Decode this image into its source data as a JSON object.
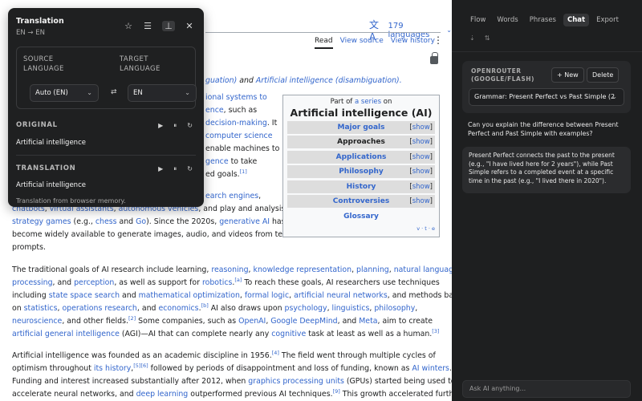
{
  "wiki": {
    "languages_label": "179 languages",
    "view_tabs": [
      "Read",
      "View source",
      "View history"
    ],
    "hatnote_rest": "guation) and ",
    "hatnote_link": "Artificial intelligence (disambiguation).",
    "p1_lines": [
      "ional systems to",
      "ence, such as",
      "decision-making. It",
      "computer science",
      "enable machines to",
      "gence to take",
      "ed goals."
    ],
    "p1_cont": [
      "earch engines,",
      "chatbots, virtual assistants, autonomous vehicles, and play and analysis in",
      "strategy games (e.g., chess and Go). Since the 2020s, generative AI has",
      "become widely available to generate images, audio, and videos from text",
      "prompts."
    ],
    "p2_lines": [
      "The traditional goals of AI research include learning, reasoning, knowledge representation, planning, natural language",
      "processing, and perception, as well as support for robotics. To reach these goals, AI researchers use techniques",
      "including state space search and mathematical optimization, formal logic, artificial neural networks, and methods based",
      "on statistics, operations research, and economics. AI also draws upon psychology, linguistics, philosophy,",
      "neuroscience, and other fields. Some companies, such as OpenAI, Google DeepMind, and Meta, aim to create",
      "artificial general intelligence (AGI)—AI that can complete nearly any cognitive task at least as well as a human."
    ],
    "p3_lines": [
      "Artificial intelligence was founded as an academic discipline in 1956. The field went through multiple cycles of",
      "optimism throughout its history, followed by periods of disappointment and loss of funding, known as AI winters.",
      "Funding and interest increased substantially after 2012, when graphics processing units (GPUs) started being used to",
      "accelerate neural networks, and deep learning outperformed previous AI techniques. This growth accelerated further"
    ],
    "infobox": {
      "pre_text": "Part of ",
      "pre_link": "a series",
      "pre_tail": " on",
      "title": "Artificial intelligence (AI)",
      "rows": [
        "Major goals",
        "Approaches",
        "Applications",
        "Philosophy",
        "History",
        "Controversies"
      ],
      "show_label": "show",
      "glossary": "Glossary",
      "vte": "v · t · e"
    }
  },
  "translation": {
    "title": "Translation",
    "pair": "EN → EN",
    "source_label": "SOURCE LANGUAGE",
    "target_label": "TARGET LANGUAGE",
    "source_value": "Auto (EN)",
    "target_value": "EN",
    "original_label": "ORIGINAL",
    "original_text": "Artificial intelligence",
    "translation_label": "TRANSLATION",
    "translation_text": "Artificial intelligence",
    "memory_note": "Translation from browser memory."
  },
  "sidebar": {
    "tabs": [
      "Flow",
      "Words",
      "Phrases",
      "Chat",
      "Export"
    ],
    "active_tab": "Chat",
    "provider": "OPENROUTER (GOOGLE/FLASH)",
    "new_label": "+ New",
    "delete_label": "Delete",
    "model_value": "Grammar: Present Perfect vs Past Simple (2",
    "user_message": "Can you explain the difference between Present Perfect and Past Simple with examples?",
    "ai_message": "Present Perfect connects the past to the present (e.g., \"I have lived here for 2 years\"), while Past Simple refers to a completed event at a specific time in the past (e.g., \"I lived there in 2020\").",
    "ask_placeholder": "Ask AI anything..."
  }
}
